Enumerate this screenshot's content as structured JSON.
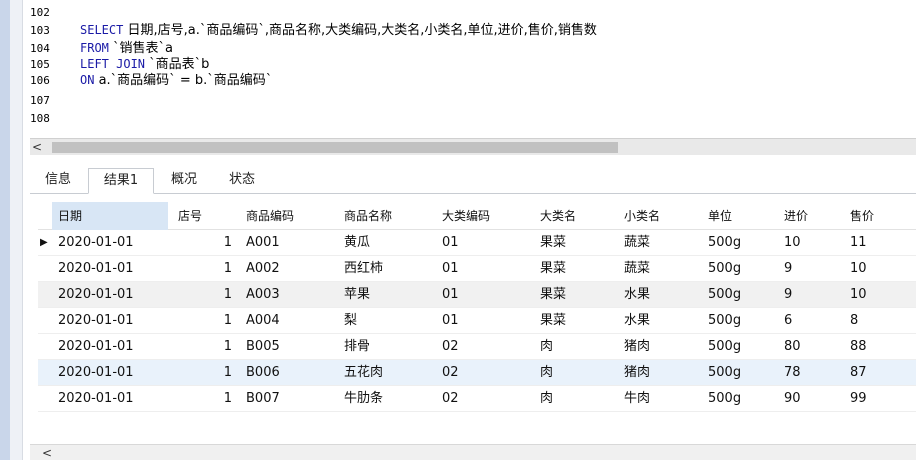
{
  "editor": {
    "lines": [
      {
        "num": "102",
        "parts": []
      },
      {
        "num": "103",
        "parts": [
          {
            "t": "SELECT",
            "k": "kw"
          },
          {
            "t": " 日期,店号,a.`商品编码`,商品名称,大类编码,大类名,小类名,单位,进价,售价,销售数",
            "k": "zh"
          }
        ]
      },
      {
        "num": "104",
        "parts": [
          {
            "t": "FROM",
            "k": "kw"
          },
          {
            "t": " `销售表`a",
            "k": "zh"
          }
        ]
      },
      {
        "num": "105",
        "parts": [
          {
            "t": "LEFT JOIN",
            "k": "kw"
          },
          {
            "t": " `商品表`b",
            "k": "zh"
          }
        ]
      },
      {
        "num": "106",
        "parts": [
          {
            "t": "ON",
            "k": "kw"
          },
          {
            "t": " a.`商品编码` = b.`商品编码`",
            "k": "zh"
          }
        ]
      },
      {
        "num": "107",
        "parts": []
      },
      {
        "num": "108",
        "parts": []
      }
    ]
  },
  "scroll": {
    "left_arrow": "<"
  },
  "tabs": [
    {
      "label": "信息",
      "active": false
    },
    {
      "label": "结果1",
      "active": true
    },
    {
      "label": "概况",
      "active": false
    },
    {
      "label": "状态",
      "active": false
    }
  ],
  "grid": {
    "columns": [
      "日期",
      "店号",
      "商品编码",
      "商品名称",
      "大类编码",
      "大类名",
      "小类名",
      "单位",
      "进价",
      "售价"
    ],
    "row_indicator": "▶",
    "rows": [
      [
        "2020-01-01",
        "1",
        "A001",
        "黄瓜",
        "01",
        "果菜",
        "蔬菜",
        "500g",
        "10",
        "11"
      ],
      [
        "2020-01-01",
        "1",
        "A002",
        "西红柿",
        "01",
        "果菜",
        "蔬菜",
        "500g",
        "9",
        "10"
      ],
      [
        "2020-01-01",
        "1",
        "A003",
        "苹果",
        "01",
        "果菜",
        "水果",
        "500g",
        "9",
        "10"
      ],
      [
        "2020-01-01",
        "1",
        "A004",
        "梨",
        "01",
        "果菜",
        "水果",
        "500g",
        "6",
        "8"
      ],
      [
        "2020-01-01",
        "1",
        "B005",
        "排骨",
        "02",
        "肉",
        "猪肉",
        "500g",
        "80",
        "88"
      ],
      [
        "2020-01-01",
        "1",
        "B006",
        "五花肉",
        "02",
        "肉",
        "猪肉",
        "500g",
        "78",
        "87"
      ],
      [
        "2020-01-01",
        "1",
        "B007",
        "牛肋条",
        "02",
        "肉",
        "牛肉",
        "500g",
        "90",
        "99"
      ]
    ],
    "row_colors": [
      "#ffffff",
      "#ffffff",
      "#f1f1f1",
      "#ffffff",
      "#ffffff",
      "#e9f2fb",
      "#ffffff"
    ]
  },
  "bottom": {
    "left_arrow": "<"
  }
}
